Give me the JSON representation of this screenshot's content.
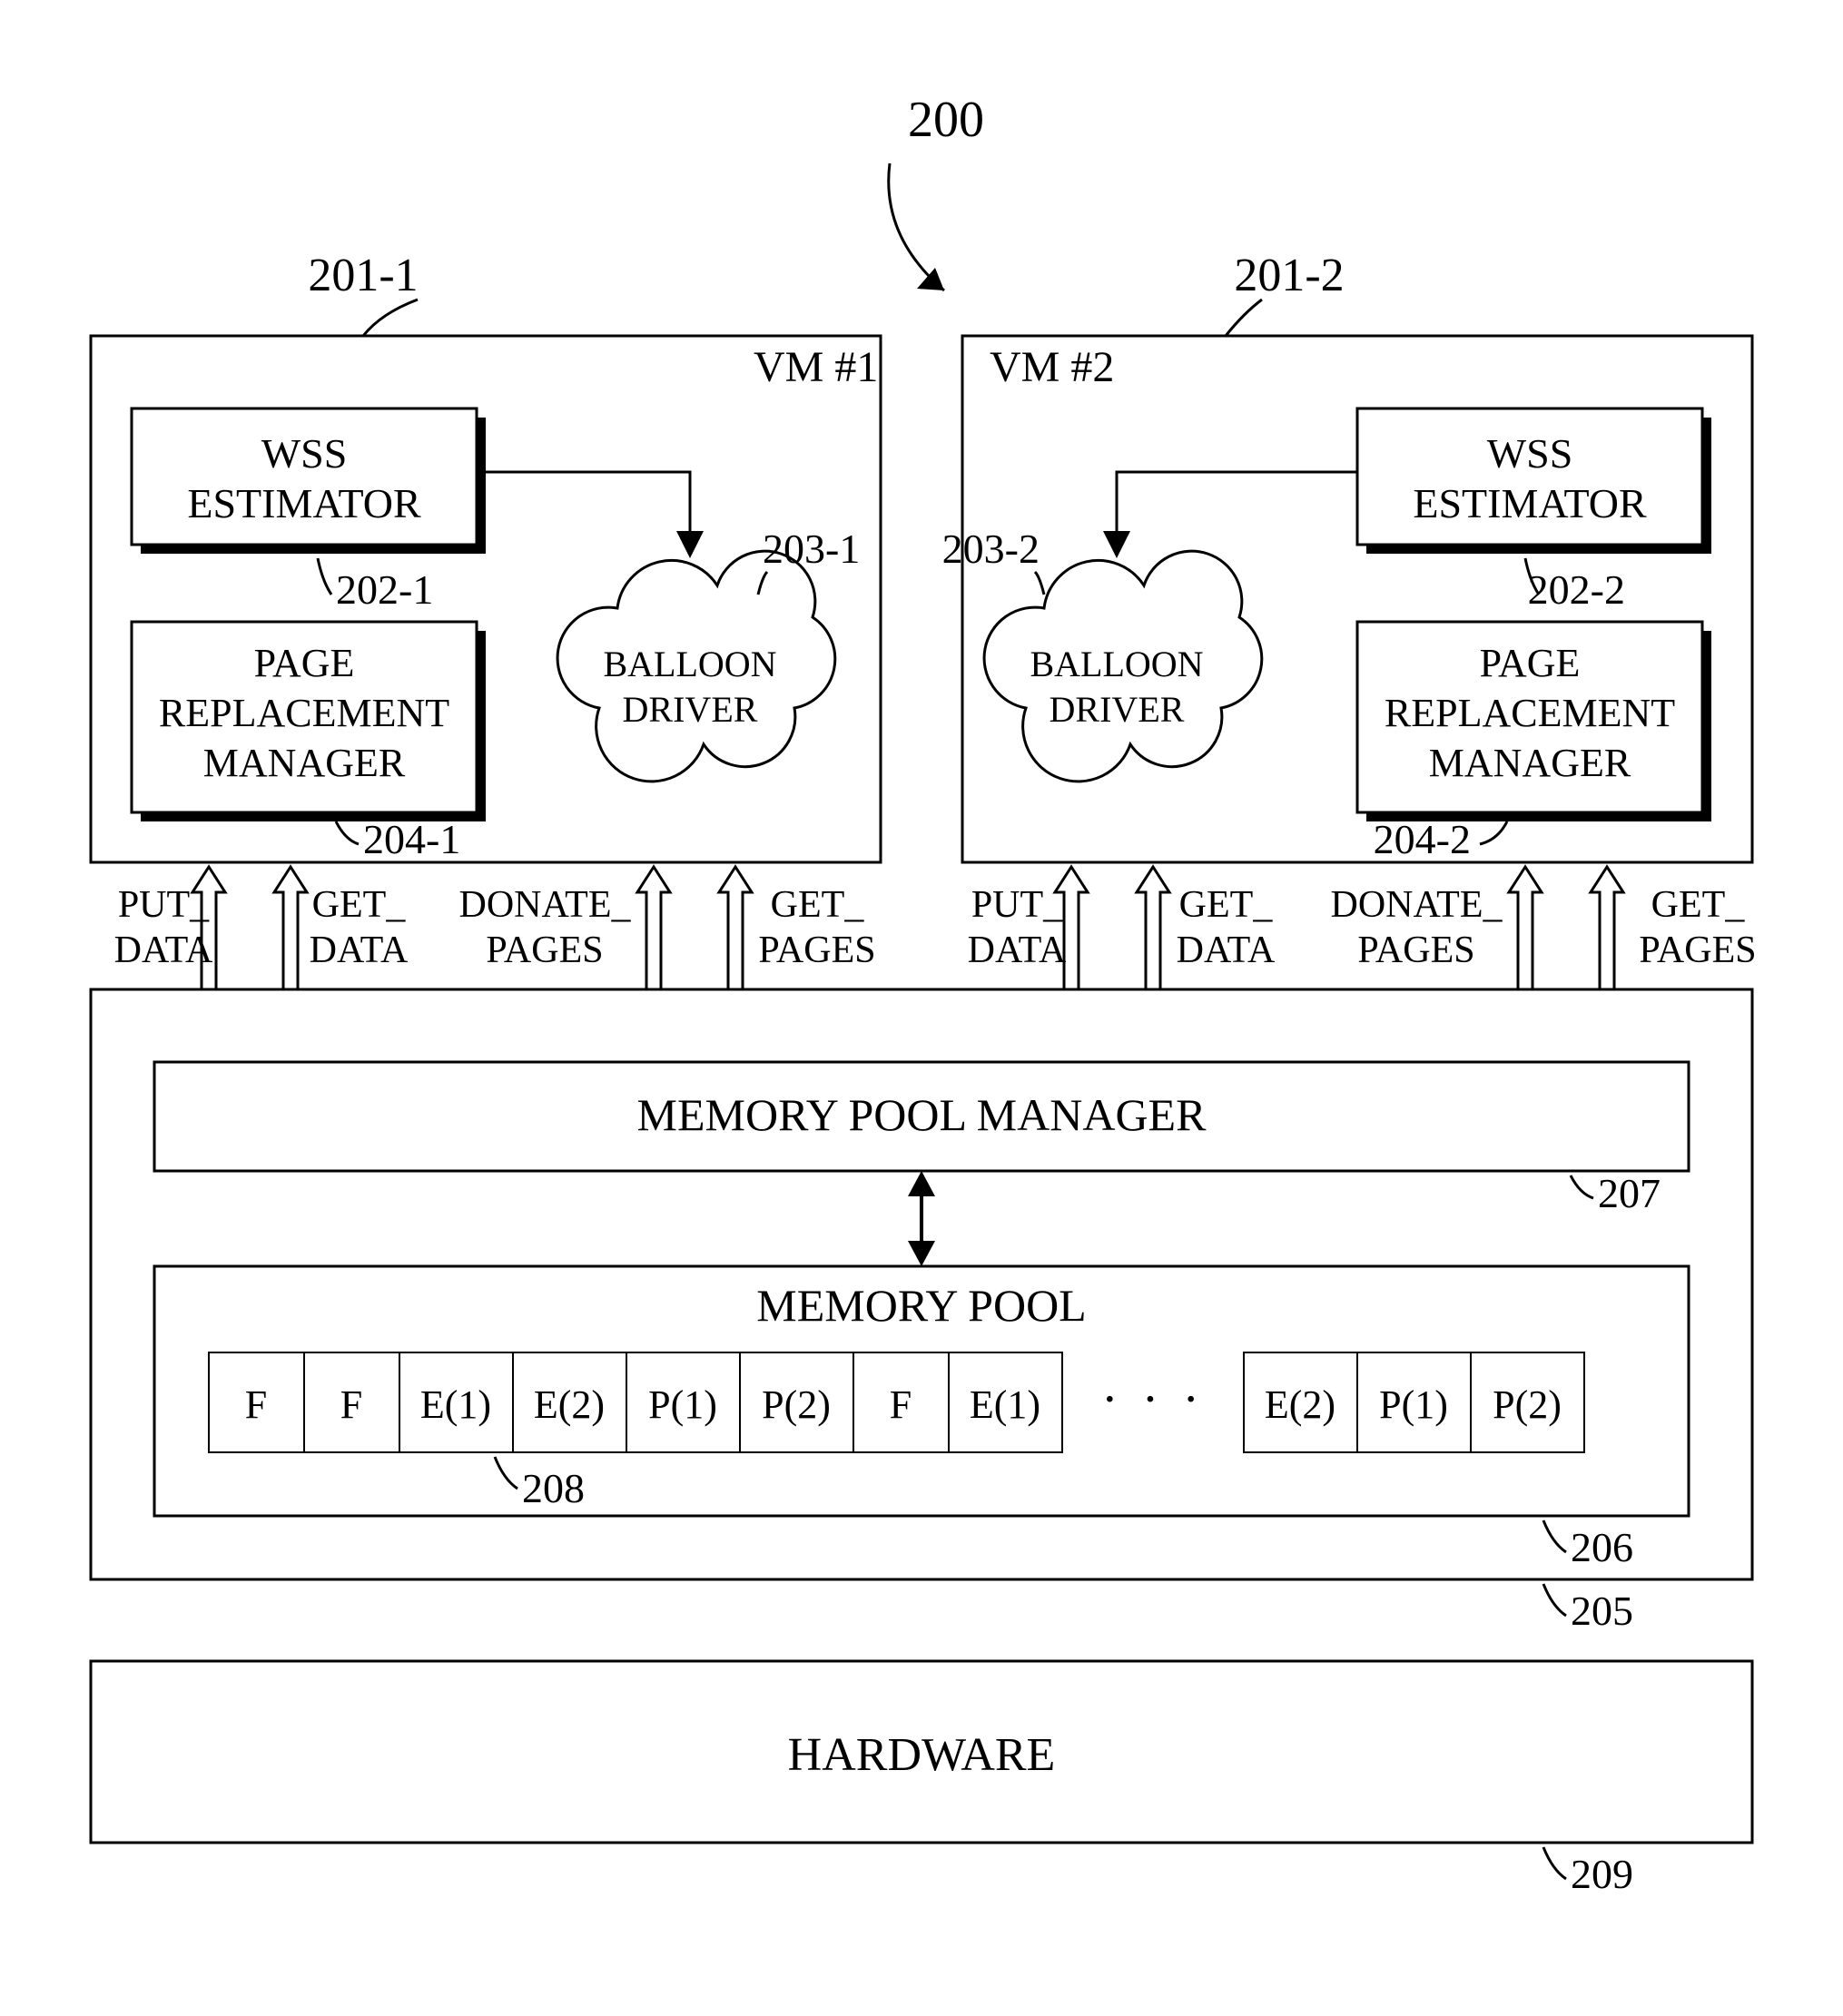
{
  "figure_label": "200",
  "vm1": {
    "title": "VM #1",
    "ref": "201-1",
    "wss": "WSS\nESTIMATOR",
    "wss_ref": "202-1",
    "prm": "PAGE\nREPLACEMENT\nMANAGER",
    "prm_ref": "204-1",
    "balloon": "BALLOON\nDRIVER",
    "balloon_ref": "203-1"
  },
  "vm2": {
    "title": "VM #2",
    "ref": "201-2",
    "wss": "WSS\nESTIMATOR",
    "wss_ref": "202-2",
    "prm": "PAGE\nREPLACEMENT\nMANAGER",
    "prm_ref": "204-2",
    "balloon": "BALLOON\nDRIVER",
    "balloon_ref": "203-2"
  },
  "api": {
    "put_data": "PUT_\nDATA",
    "get_data": "GET_\nDATA",
    "donate_pages": "DONATE_\nPAGES",
    "get_pages": "GET_\nPAGES"
  },
  "hypervisor": {
    "mpm": "MEMORY POOL MANAGER",
    "mpm_ref": "207",
    "mpool": "MEMORY POOL",
    "mpool_ref": "206",
    "hv_ref": "205",
    "pages_ref": "208",
    "pages_left": [
      "F",
      "F",
      "E(1)",
      "E(2)",
      "P(1)",
      "P(2)",
      "F",
      "E(1)"
    ],
    "ellipsis": "· · ·",
    "pages_right": [
      "E(2)",
      "P(1)",
      "P(2)"
    ]
  },
  "hardware": {
    "label": "HARDWARE",
    "ref": "209"
  }
}
